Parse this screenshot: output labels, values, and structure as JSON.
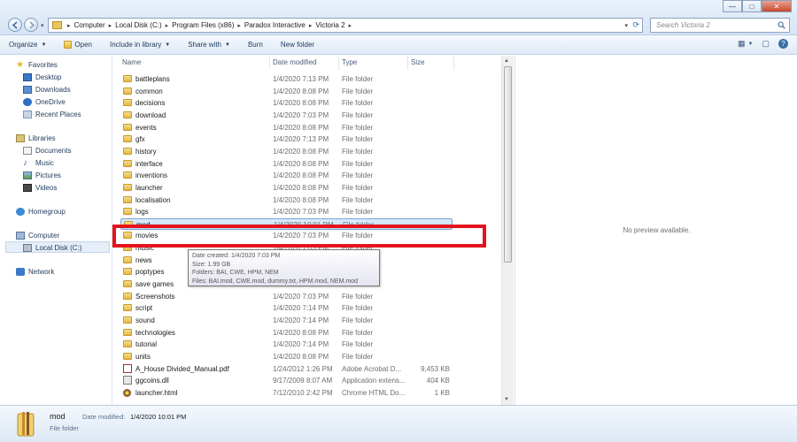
{
  "window": {
    "minimize_label": "—",
    "maximize_label": "□",
    "close_label": "✕"
  },
  "address": {
    "crumbs": [
      "Computer",
      "Local Disk (C:)",
      "Program Files (x86)",
      "Paradox Interactive",
      "Victoria 2"
    ],
    "separator": "▸"
  },
  "search": {
    "placeholder": "Search Victoria 2"
  },
  "toolbar": {
    "organize": "Organize",
    "open": "Open",
    "include_in_library": "Include in library",
    "share_with": "Share with",
    "burn": "Burn",
    "new_folder": "New folder"
  },
  "nav": {
    "favorites": "Favorites",
    "desktop": "Desktop",
    "downloads": "Downloads",
    "onedrive": "OneDrive",
    "recent_places": "Recent Places",
    "libraries": "Libraries",
    "documents": "Documents",
    "music": "Music",
    "pictures": "Pictures",
    "videos": "Videos",
    "homegroup": "Homegroup",
    "computer": "Computer",
    "local_disk": "Local Disk (C:)",
    "network": "Network"
  },
  "columns": {
    "name": "Name",
    "date": "Date modified",
    "type": "Type",
    "size": "Size"
  },
  "files": [
    {
      "name": "battleplans",
      "date": "1/4/2020 7:13 PM",
      "type": "File folder",
      "size": "",
      "kind": "folder"
    },
    {
      "name": "common",
      "date": "1/4/2020 8:08 PM",
      "type": "File folder",
      "size": "",
      "kind": "folder"
    },
    {
      "name": "decisions",
      "date": "1/4/2020 8:08 PM",
      "type": "File folder",
      "size": "",
      "kind": "folder"
    },
    {
      "name": "download",
      "date": "1/4/2020 7:03 PM",
      "type": "File folder",
      "size": "",
      "kind": "folder"
    },
    {
      "name": "events",
      "date": "1/4/2020 8:08 PM",
      "type": "File folder",
      "size": "",
      "kind": "folder"
    },
    {
      "name": "gfx",
      "date": "1/4/2020 7:13 PM",
      "type": "File folder",
      "size": "",
      "kind": "folder"
    },
    {
      "name": "history",
      "date": "1/4/2020 8:08 PM",
      "type": "File folder",
      "size": "",
      "kind": "folder"
    },
    {
      "name": "interface",
      "date": "1/4/2020 8:08 PM",
      "type": "File folder",
      "size": "",
      "kind": "folder"
    },
    {
      "name": "inventions",
      "date": "1/4/2020 8:08 PM",
      "type": "File folder",
      "size": "",
      "kind": "folder"
    },
    {
      "name": "launcher",
      "date": "1/4/2020 8:08 PM",
      "type": "File folder",
      "size": "",
      "kind": "folder"
    },
    {
      "name": "localisation",
      "date": "1/4/2020 8:08 PM",
      "type": "File folder",
      "size": "",
      "kind": "folder"
    },
    {
      "name": "logs",
      "date": "1/4/2020 7:03 PM",
      "type": "File folder",
      "size": "",
      "kind": "folder"
    },
    {
      "name": "mod",
      "date": "1/4/2020 10:01 PM",
      "type": "File folder",
      "size": "",
      "kind": "folder",
      "selected": true
    },
    {
      "name": "movies",
      "date": "1/4/2020 7:03 PM",
      "type": "File folder",
      "size": "",
      "kind": "folder"
    },
    {
      "name": "music",
      "date": "1/4/2020 7:03 PM",
      "type": "File folder",
      "size": "",
      "kind": "folder"
    },
    {
      "name": "news",
      "date": "1/4/2020 8:08 PM",
      "type": "File folder",
      "size": "",
      "kind": "folder"
    },
    {
      "name": "poptypes",
      "date": "1/4/2020 8:08 PM",
      "type": "File folder",
      "size": "",
      "kind": "folder"
    },
    {
      "name": "save games",
      "date": "1/4/2020 7:03 PM",
      "type": "File folder",
      "size": "",
      "kind": "folder"
    },
    {
      "name": "Screenshots",
      "date": "1/4/2020 7:03 PM",
      "type": "File folder",
      "size": "",
      "kind": "folder"
    },
    {
      "name": "script",
      "date": "1/4/2020 7:14 PM",
      "type": "File folder",
      "size": "",
      "kind": "folder"
    },
    {
      "name": "sound",
      "date": "1/4/2020 7:14 PM",
      "type": "File folder",
      "size": "",
      "kind": "folder"
    },
    {
      "name": "technologies",
      "date": "1/4/2020 8:08 PM",
      "type": "File folder",
      "size": "",
      "kind": "folder"
    },
    {
      "name": "tutorial",
      "date": "1/4/2020 7:14 PM",
      "type": "File folder",
      "size": "",
      "kind": "folder"
    },
    {
      "name": "units",
      "date": "1/4/2020 8:08 PM",
      "type": "File folder",
      "size": "",
      "kind": "folder"
    },
    {
      "name": "A_House Divided_Manual.pdf",
      "date": "1/24/2012 1:26 PM",
      "type": "Adobe Acrobat D...",
      "size": "9,453 KB",
      "kind": "pdf"
    },
    {
      "name": "ggcoins.dll",
      "date": "9/17/2009 8:07 AM",
      "type": "Application extens...",
      "size": "404 KB",
      "kind": "dll"
    },
    {
      "name": "launcher.html",
      "date": "7/12/2010 2:42 PM",
      "type": "Chrome HTML Do...",
      "size": "1 KB",
      "kind": "html"
    }
  ],
  "tooltip": {
    "created": "Date created: 1/4/2020 7:03 PM",
    "size": "Size: 1.99 GB",
    "folders": "Folders: BAI, CWE, HPM, NEM",
    "files": "Files: BAI.mod, CWE.mod, dummy.txt, HPM.mod, NEM.mod"
  },
  "preview": {
    "text": "No preview available."
  },
  "details": {
    "name": "mod",
    "date_label": "Date modified:",
    "date_value": "1/4/2020 10:01 PM",
    "kind": "File folder"
  },
  "colors": {
    "highlight": "#e3141c",
    "selection": "#c1dcfc",
    "folder": "#e3b942"
  }
}
